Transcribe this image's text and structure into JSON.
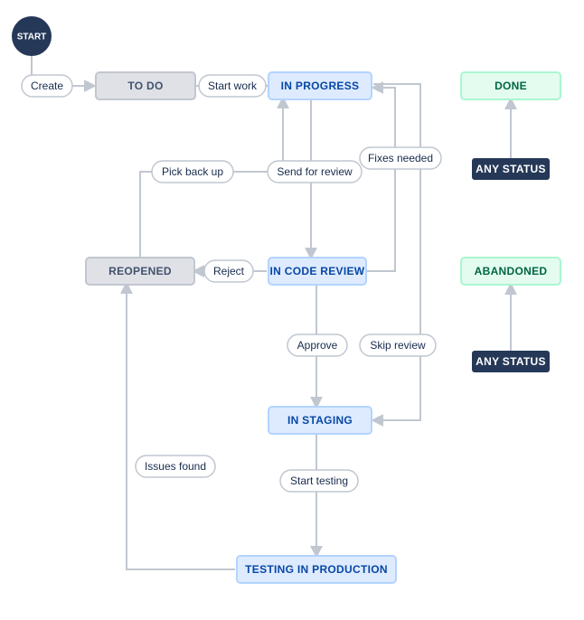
{
  "workflow": {
    "start_label": "START",
    "statuses": {
      "todo": {
        "label": "TO DO",
        "category": "todo"
      },
      "in_progress": {
        "label": "IN PROGRESS",
        "category": "inprogress"
      },
      "in_code_review": {
        "label": "IN CODE REVIEW",
        "category": "inprogress"
      },
      "in_staging": {
        "label": "IN STAGING",
        "category": "inprogress"
      },
      "testing_in_production": {
        "label": "TESTING IN PRODUCTION",
        "category": "inprogress"
      },
      "reopened": {
        "label": "REOPENED",
        "category": "todo"
      },
      "done": {
        "label": "DONE",
        "category": "done"
      },
      "abandoned": {
        "label": "ABANDONED",
        "category": "done"
      },
      "any_status_1": {
        "label": "ANY STATUS",
        "category": "any"
      },
      "any_status_2": {
        "label": "ANY STATUS",
        "category": "any"
      }
    },
    "transitions": {
      "create": "Create",
      "start_work": "Start work",
      "send_for_review": "Send for review",
      "pick_back_up": "Pick back up",
      "fixes_needed": "Fixes needed",
      "reject": "Reject",
      "approve": "Approve",
      "skip_review": "Skip review",
      "start_testing": "Start testing",
      "issues_found": "Issues found"
    }
  },
  "colors": {
    "todo_fill": "#DFE1E6",
    "todo_stroke": "#C1C7D0",
    "todo_text": "#42526E",
    "inprogress_fill": "#DEEBFF",
    "inprogress_stroke": "#B3D4FF",
    "inprogress_text": "#0747A6",
    "done_fill": "#E3FCEF",
    "done_stroke": "#ABF5D1",
    "done_text": "#006644",
    "any_fill": "#253858",
    "any_text": "#FFFFFF",
    "start_fill": "#253858",
    "pill_fill": "#FFFFFF",
    "pill_stroke": "#C1C7D0",
    "edge": "#C1C7D0"
  }
}
